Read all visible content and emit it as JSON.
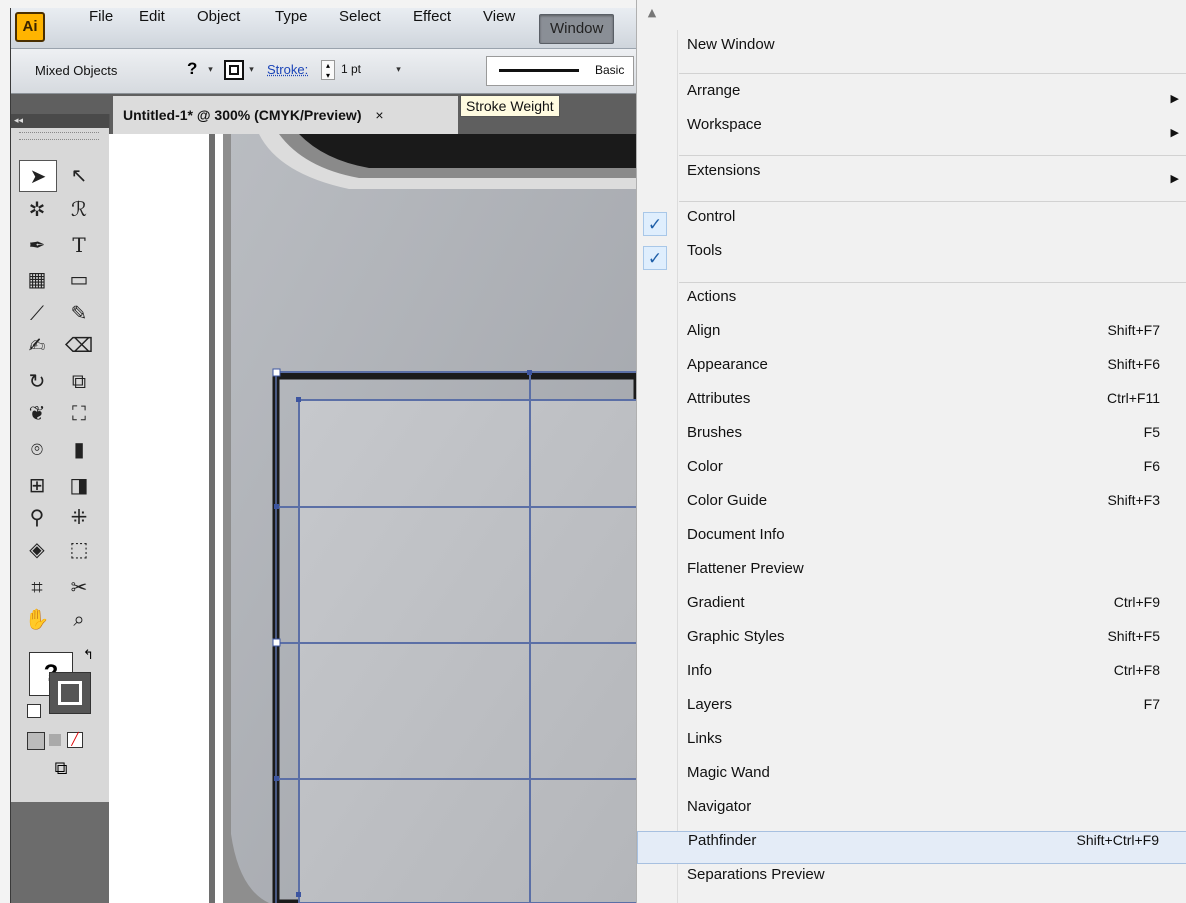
{
  "app": {
    "logo": "Ai",
    "menus": [
      "File",
      "Edit",
      "Object",
      "Type",
      "Select",
      "Effect",
      "View",
      "Window"
    ]
  },
  "control_bar": {
    "selection": "Mixed Objects",
    "fill_symbol": "?",
    "stroke_label": "Stroke:",
    "stroke_weight": "1 pt",
    "brush_profile": "Basic"
  },
  "document": {
    "tab_title": "Untitled-1* @ 300% (CMYK/Preview)",
    "tab_close": "×"
  },
  "tooltip": {
    "text": "Stroke Weight"
  },
  "tools": {
    "fill_symbol": "?",
    "collapse_glyph": "◂◂"
  },
  "window_menu": {
    "items": [
      {
        "label": "New Window",
        "shortcut": ""
      },
      {
        "label": "Arrange",
        "shortcut": "",
        "submenu": true
      },
      {
        "label": "Workspace",
        "shortcut": "",
        "submenu": true
      },
      {
        "label": "Extensions",
        "shortcut": "",
        "submenu": true
      },
      {
        "label": "Control",
        "shortcut": "",
        "checked": true
      },
      {
        "label": "Tools",
        "shortcut": "",
        "checked": true
      },
      {
        "label": "Actions",
        "shortcut": ""
      },
      {
        "label": "Align",
        "shortcut": "Shift+F7"
      },
      {
        "label": "Appearance",
        "shortcut": "Shift+F6"
      },
      {
        "label": "Attributes",
        "shortcut": "Ctrl+F11"
      },
      {
        "label": "Brushes",
        "shortcut": "F5"
      },
      {
        "label": "Color",
        "shortcut": "F6"
      },
      {
        "label": "Color Guide",
        "shortcut": "Shift+F3"
      },
      {
        "label": "Document Info",
        "shortcut": ""
      },
      {
        "label": "Flattener Preview",
        "shortcut": ""
      },
      {
        "label": "Gradient",
        "shortcut": "Ctrl+F9"
      },
      {
        "label": "Graphic Styles",
        "shortcut": "Shift+F5"
      },
      {
        "label": "Info",
        "shortcut": "Ctrl+F8"
      },
      {
        "label": "Layers",
        "shortcut": "F7"
      },
      {
        "label": "Links",
        "shortcut": ""
      },
      {
        "label": "Magic Wand",
        "shortcut": ""
      },
      {
        "label": "Navigator",
        "shortcut": ""
      },
      {
        "label": "Pathfinder",
        "shortcut": "Shift+Ctrl+F9",
        "highlighted": true
      },
      {
        "label": "Separations Preview",
        "shortcut": ""
      }
    ],
    "check_glyph": "✓",
    "submenu_glyph": "▶",
    "scroll_up_glyph": "▲"
  }
}
